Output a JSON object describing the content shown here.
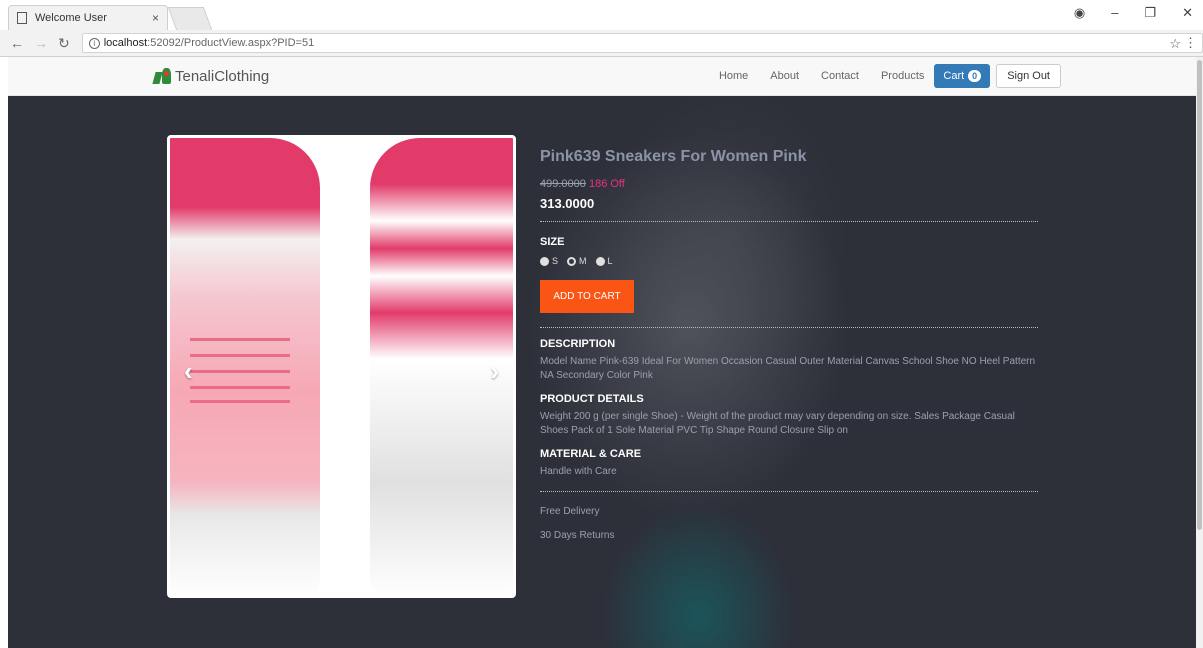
{
  "browser": {
    "tab_title": "Welcome User",
    "tab_close": "×",
    "url_host": "localhost",
    "url_rest": ":52092/ProductView.aspx?PID=51",
    "icons": [
      "back-arrow-icon",
      "forward-arrow-icon",
      "reload-icon",
      "info-icon",
      "star-icon",
      "menu-icon",
      "profile-icon",
      "minimize-icon",
      "maximize-icon",
      "close-icon"
    ]
  },
  "navbar": {
    "brand": "TenaliClothing",
    "links": [
      "Home",
      "About",
      "Contact",
      "Products"
    ],
    "cart_label": "Cart",
    "cart_count": "0",
    "signout_label": "Sign Out",
    "cart_color": "#337ab7"
  },
  "product": {
    "title": "Pink639 Sneakers For Women Pink",
    "old_price": "499.0000",
    "discount": "186 Off",
    "price": "313.0000",
    "size_label": "SIZE",
    "sizes": [
      "S",
      "M",
      "L"
    ],
    "selected_size": "M",
    "add_to_cart": "ADD TO CART",
    "add_to_cart_color": "#fb5516",
    "description_head": "DESCRIPTION",
    "description": "Model Name Pink-639 Ideal For Women Occasion Casual Outer Material Canvas School Shoe NO Heel Pattern NA Secondary Color Pink",
    "details_head": "PRODUCT DETAILS",
    "details": "Weight 200 g (per single Shoe) - Weight of the product may vary depending on size. Sales Package Casual Shoes Pack of 1 Sole Material PVC Tip Shape Round Closure Slip on",
    "care_head": "MATERIAL & CARE",
    "care": "Handle with Care",
    "extras": [
      "Free Delivery",
      "30 Days Returns"
    ]
  },
  "carousel": {
    "prev": "‹",
    "next": "›"
  }
}
